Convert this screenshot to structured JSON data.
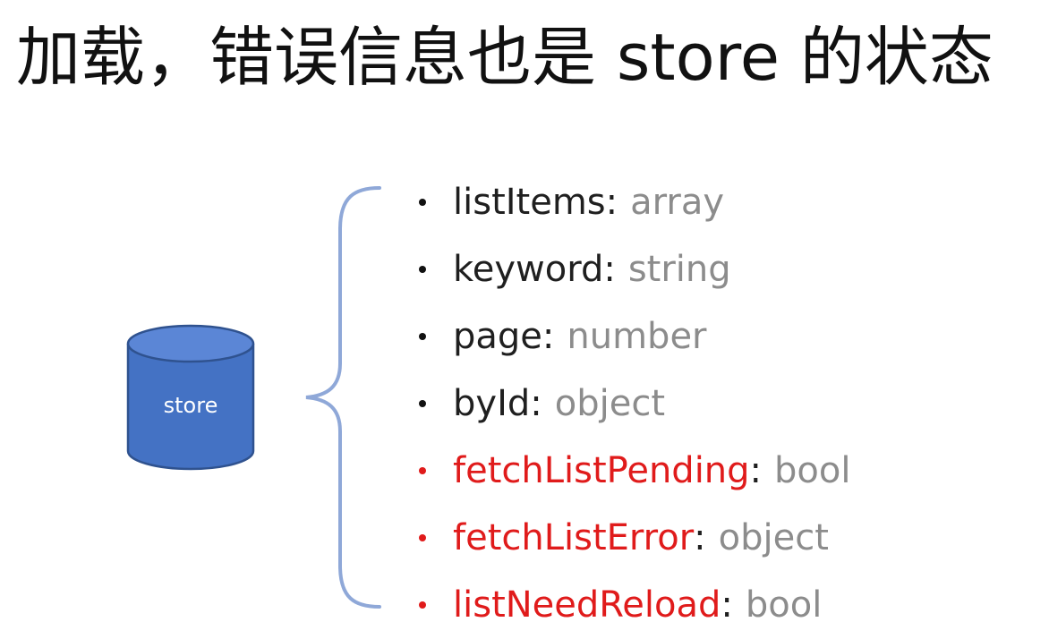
{
  "title": "加载，错误信息也是 store 的状态",
  "store": {
    "label": "store",
    "fill_color": "#4472c4",
    "stroke_color": "#2f528f"
  },
  "brace_color": "#8fa8d8",
  "properties": [
    {
      "name": "listItems",
      "colon": ":",
      "type": "array",
      "highlight": false
    },
    {
      "name": "keyword",
      "colon": ":",
      "type": "string",
      "highlight": false
    },
    {
      "name": "page",
      "colon": ":",
      "type": "number",
      "highlight": false
    },
    {
      "name": "byId",
      "colon": ":",
      "type": "object",
      "highlight": false
    },
    {
      "name": "fetchListPending",
      "colon": ":",
      "type": "bool",
      "highlight": true
    },
    {
      "name": "fetchListError",
      "colon": ":",
      "type": "object",
      "highlight": true
    },
    {
      "name": "listNeedReload",
      "colon": ":",
      "type": "bool",
      "highlight": true
    }
  ],
  "highlight_color": "#e01b1b"
}
